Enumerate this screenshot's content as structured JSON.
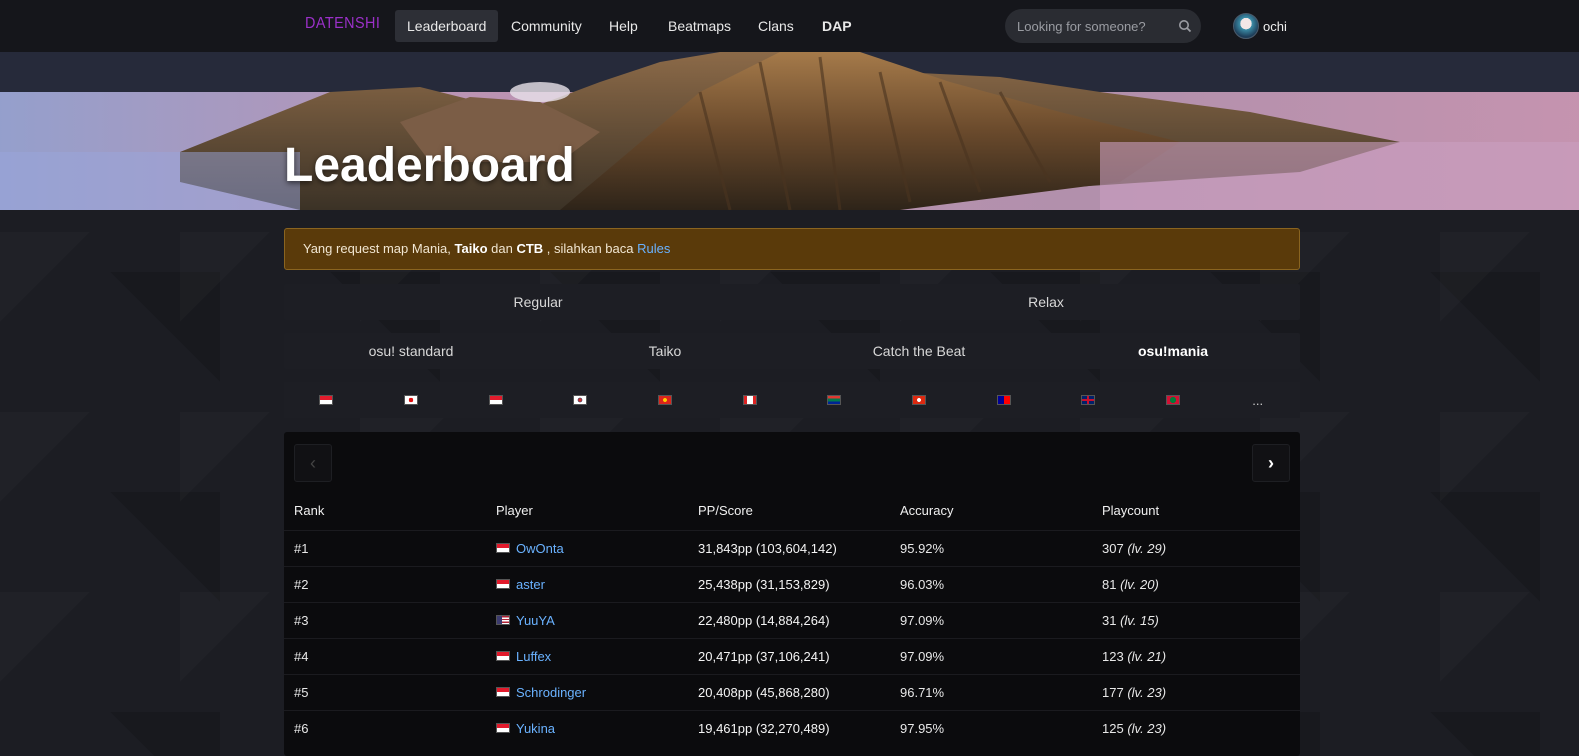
{
  "nav": {
    "brand": "DATENSHI",
    "items": [
      {
        "label": "Leaderboard",
        "active": true
      },
      {
        "label": "Community"
      },
      {
        "label": "Help"
      },
      {
        "label": "Beatmaps"
      },
      {
        "label": "Clans"
      },
      {
        "label": "DAP"
      }
    ],
    "search_placeholder": "Looking for someone?",
    "username": "ochi"
  },
  "hero": {
    "title": "Leaderboard"
  },
  "alert": {
    "prefix": "Yang request map Mania, ",
    "bold1": "Taiko",
    "mid": " dan ",
    "bold2": "CTB",
    "suffix": " , silahkan baca ",
    "link": "Rules"
  },
  "modes": [
    "Regular",
    "Relax"
  ],
  "gamemodes": [
    "osu! standard",
    "Taiko",
    "Catch the Beat",
    "osu!mania"
  ],
  "active_gamemode": "osu!mania",
  "flags": [
    {
      "country": "Indonesia",
      "icon": "flag-id-icon"
    },
    {
      "country": "Japan",
      "icon": "flag-jp-icon"
    },
    {
      "country": "Indonesia",
      "icon": "flag-id-icon"
    },
    {
      "country": "South Korea",
      "icon": "flag-kr-icon"
    },
    {
      "country": "Vietnam",
      "icon": "flag-vn-icon"
    },
    {
      "country": "Canada",
      "icon": "flag-ca-icon"
    },
    {
      "country": "South Africa",
      "icon": "flag-za-icon"
    },
    {
      "country": "Hong Kong",
      "icon": "flag-hk-icon"
    },
    {
      "country": "Taiwan",
      "icon": "flag-tw-icon"
    },
    {
      "country": "United Kingdom",
      "icon": "flag-gb-icon"
    },
    {
      "country": "Maldives",
      "icon": "flag-mv-icon"
    }
  ],
  "flags_more": "...",
  "table": {
    "headers": [
      "Rank",
      "Player",
      "PP/Score",
      "Accuracy",
      "Playcount"
    ],
    "rows": [
      {
        "rank": "#1",
        "player": "OwOnta",
        "flag": "flag-id-icon",
        "pp": "31,843pp",
        "score": " (103,604,142)",
        "accuracy": "95.92%",
        "playcount": "307",
        "level": " (lv. 29)"
      },
      {
        "rank": "#2",
        "player": "aster",
        "flag": "flag-id-icon",
        "pp": "25,438pp",
        "score": " (31,153,829)",
        "accuracy": "96.03%",
        "playcount": "81",
        "level": " (lv. 20)"
      },
      {
        "rank": "#3",
        "player": "YuuYA",
        "flag": "flag-us-icon",
        "pp": "22,480pp",
        "score": " (14,884,264)",
        "accuracy": "97.09%",
        "playcount": "31",
        "level": " (lv. 15)"
      },
      {
        "rank": "#4",
        "player": "Luffex",
        "flag": "flag-id-icon",
        "pp": "20,471pp",
        "score": " (37,106,241)",
        "accuracy": "97.09%",
        "playcount": "123",
        "level": " (lv. 21)"
      },
      {
        "rank": "#5",
        "player": "Schrodinger",
        "flag": "flag-id-icon",
        "pp": "20,408pp",
        "score": " (45,868,280)",
        "accuracy": "96.71%",
        "playcount": "177",
        "level": " (lv. 23)"
      },
      {
        "rank": "#6",
        "player": "Yukina",
        "flag": "flag-id-icon",
        "pp": "19,461pp",
        "score": " (32,270,489)",
        "accuracy": "97.95%",
        "playcount": "125",
        "level": " (lv. 23)"
      }
    ]
  },
  "colors": {
    "brand": "#9b30c9",
    "link": "#6ab2ff",
    "alert_bg": "#5a3a0a",
    "alert_border": "#8a6420"
  }
}
